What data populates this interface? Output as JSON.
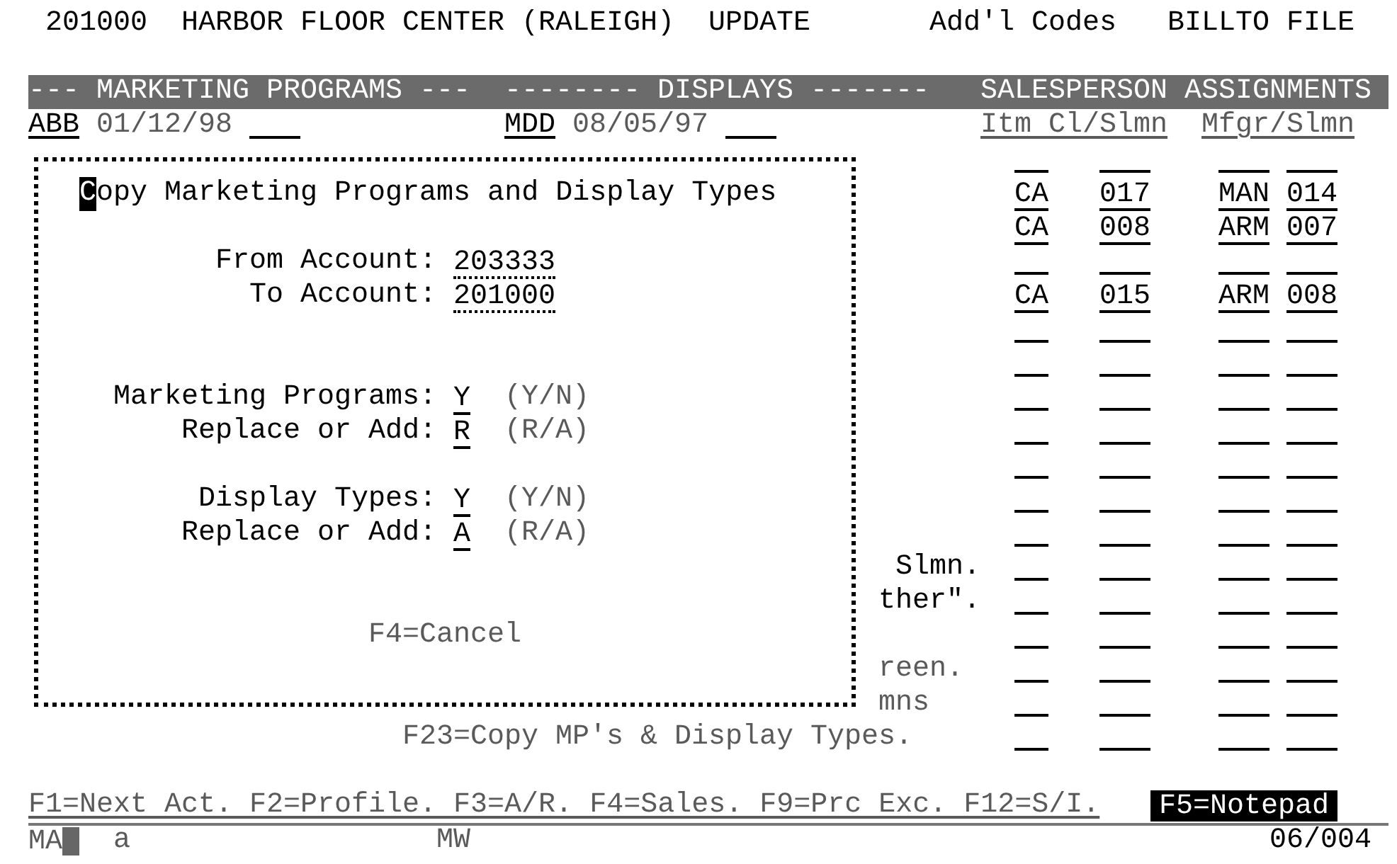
{
  "header": {
    "account": "201000",
    "customer": "HARBOR FLOOR CENTER (RALEIGH)",
    "mode": "UPDATE",
    "section": "Add'l Codes",
    "file": "BILLTO FILE"
  },
  "section_bar": [
    "--- MARKETING PROGRAMS ---",
    "-------- DISPLAYS -------",
    "SALESPERSON ASSIGNMENTS"
  ],
  "programs": [
    {
      "code": "ABB",
      "date": "01/12/98"
    },
    {
      "code": "MDD",
      "date": "08/05/97"
    }
  ],
  "assignment_headers": [
    "Itm Cl/Slmn",
    "Mfgr/Slmn"
  ],
  "assignments": [
    {
      "kind": "blank"
    },
    {
      "kind": "entry",
      "item_class": "CA",
      "salesperson": "017",
      "manufacturer": "MAN",
      "mfgr_salesperson": "014"
    },
    {
      "kind": "entry",
      "item_class": "CA",
      "salesperson": "008",
      "manufacturer": "ARM",
      "mfgr_salesperson": "007"
    },
    {
      "kind": "blank"
    },
    {
      "kind": "entry",
      "item_class": "CA",
      "salesperson": "015",
      "manufacturer": "ARM",
      "mfgr_salesperson": "008"
    },
    {
      "kind": "blank"
    },
    {
      "kind": "blank"
    },
    {
      "kind": "blank"
    },
    {
      "kind": "blank"
    },
    {
      "kind": "blank"
    },
    {
      "kind": "blank"
    },
    {
      "kind": "blank"
    },
    {
      "kind": "blank"
    },
    {
      "kind": "blank"
    },
    {
      "kind": "blank"
    },
    {
      "kind": "blank"
    },
    {
      "kind": "blank"
    },
    {
      "kind": "blank"
    }
  ],
  "dialog": {
    "title": "Copy Marketing Programs and Display Types",
    "fields": [
      {
        "kind": "account",
        "label": "From Account:",
        "value": "203333"
      },
      {
        "kind": "account",
        "label": "To Account:",
        "value": "201000"
      },
      {
        "kind": "choice",
        "label": "Marketing Programs:",
        "value": "Y",
        "hint": "(Y/N)"
      },
      {
        "kind": "choice",
        "label": "Replace or Add:",
        "value": "R",
        "hint": "(R/A)"
      },
      {
        "kind": "choice",
        "label": "Display Types:",
        "value": "Y",
        "hint": "(Y/N)"
      },
      {
        "kind": "choice",
        "label": "Replace or Add:",
        "value": "A",
        "hint": "(R/A)"
      }
    ],
    "cancel": "F4=Cancel"
  },
  "behind_fragments": [
    {
      "text": "Slmn.",
      "dim": false
    },
    {
      "text": "ther\".",
      "dim": false
    },
    {
      "text": "reen.",
      "dim": true
    },
    {
      "text": "mns",
      "dim": true
    }
  ],
  "command_hint": "F23=Copy MP's & Display Types.",
  "function_keys": "F1=Next Act. F2=Profile. F3=A/R. F4=Sales. F9=Prc Exc. F12=S/I.",
  "notepad_key": "F5=Notepad",
  "status_line": {
    "session": "MA",
    "mode": "a",
    "indicator": "MW",
    "position": "06/004"
  }
}
